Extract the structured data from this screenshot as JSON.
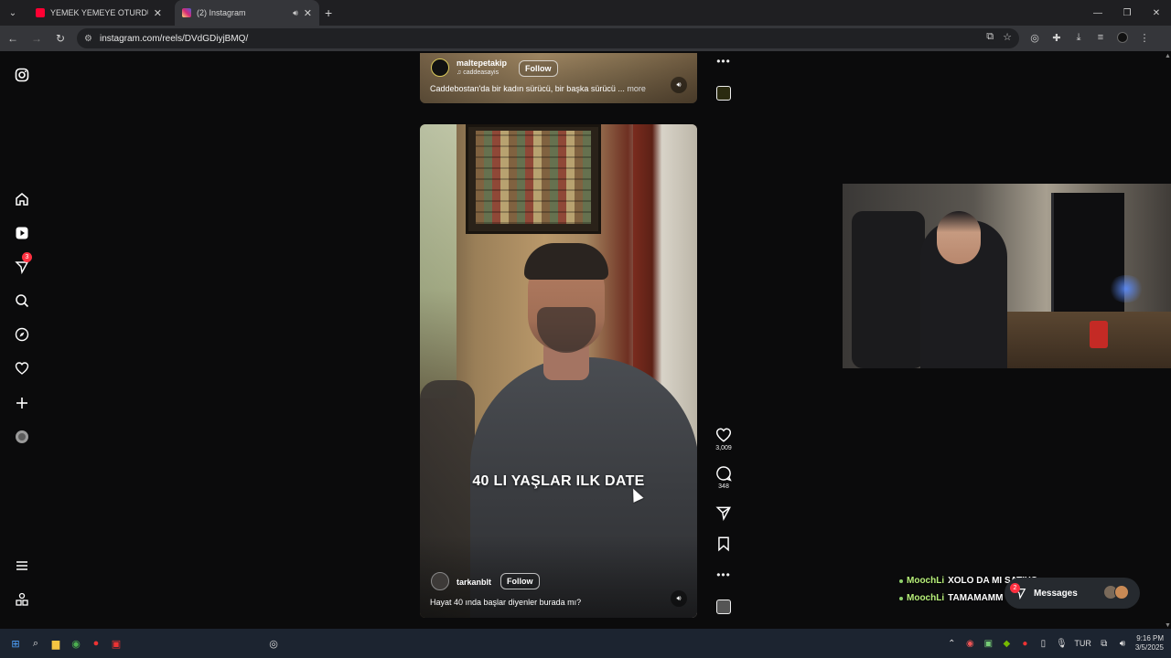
{
  "browser": {
    "tabs": [
      {
        "title": "YEMEK YEMEYE OTURDUK, AZ",
        "favicon_color": "#ff0033",
        "active": false
      },
      {
        "title": "(2) Instagram",
        "favicon_color": "#d62976",
        "active": true
      }
    ],
    "url": "instagram.com/reels/DVdGDiyjBMQ/"
  },
  "sidebar": {
    "notification_count": "3",
    "items": [
      "instagram-logo",
      "home",
      "reels",
      "messages",
      "search",
      "explore",
      "notifications",
      "create",
      "profile",
      "more",
      "also-from-meta"
    ]
  },
  "reel_top": {
    "username": "maltepetakip",
    "audio": "caddeasayis",
    "follow_label": "Follow",
    "caption": "Caddebostan'da bir kadın sürücü, bir başka sürücü ...",
    "more_label": "more"
  },
  "reel_main": {
    "overlay_text": "40 LI YAŞLAR ILK DATE",
    "username": "tarkanblt",
    "follow_label": "Follow",
    "caption": "Hayat 40 ında başlar diyenler burada mı?"
  },
  "actions": {
    "likes": "3,009",
    "comments": "348"
  },
  "chat": [
    {
      "user": "MoochLi",
      "message": "XOLO DA MI SATIYO"
    },
    {
      "user": "MoochLi",
      "message": "TAMAMAMM"
    }
  ],
  "messages_pill": {
    "label": "Messages",
    "badge": "2"
  },
  "taskbar": {
    "language": "TUR",
    "time": "9:16 PM",
    "date": "3/5/2025"
  },
  "colors": {
    "accent_red": "#ff3040",
    "chat_user": "#b8f07a"
  }
}
